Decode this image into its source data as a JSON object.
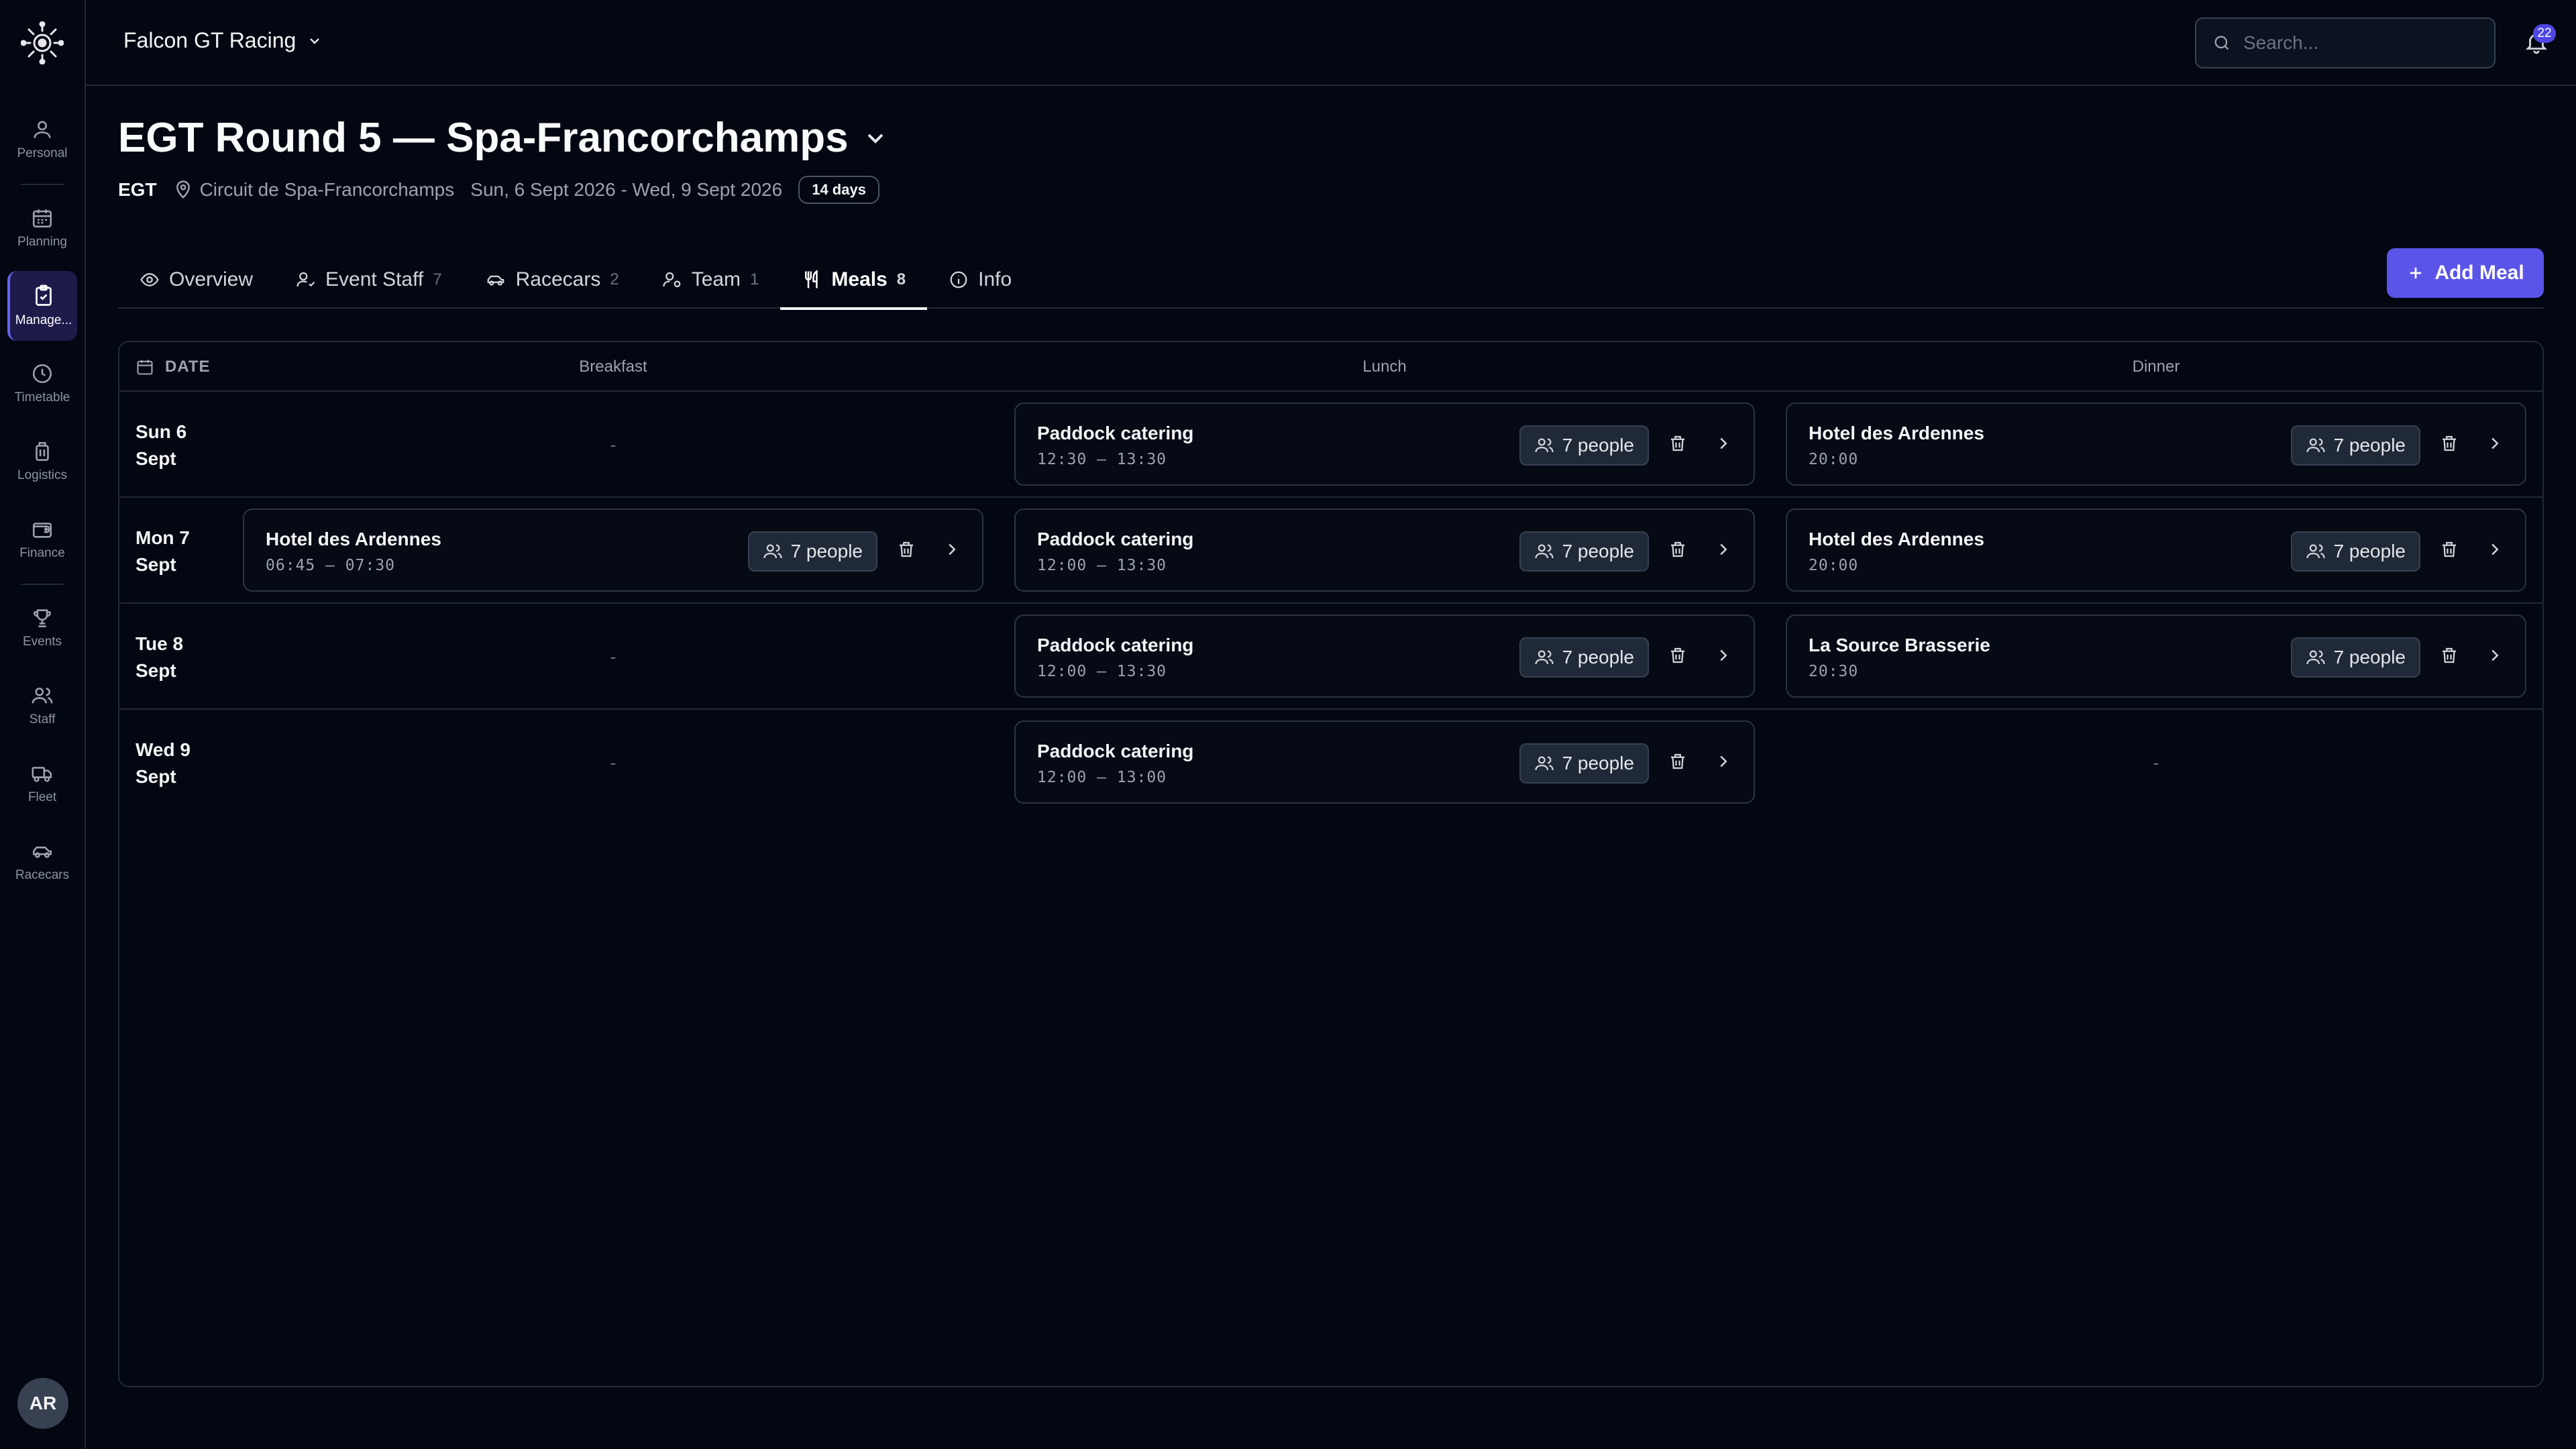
{
  "app": {
    "org_name": "Falcon GT Racing",
    "notifications_count": "22"
  },
  "search": {
    "placeholder": "Search..."
  },
  "sidebar": {
    "items": [
      {
        "key": "personal",
        "label": "Personal",
        "icon": "user-icon"
      },
      {
        "key": "planning",
        "label": "Planning",
        "icon": "calendar-icon"
      },
      {
        "key": "manage",
        "label": "Manage...",
        "icon": "clipboard-check-icon"
      },
      {
        "key": "timetable",
        "label": "Timetable",
        "icon": "clock-icon"
      },
      {
        "key": "logistics",
        "label": "Logistics",
        "icon": "luggage-icon"
      },
      {
        "key": "finance",
        "label": "Finance",
        "icon": "wallet-icon"
      },
      {
        "key": "events",
        "label": "Events",
        "icon": "trophy-icon"
      },
      {
        "key": "staff",
        "label": "Staff",
        "icon": "users-icon"
      },
      {
        "key": "fleet",
        "label": "Fleet",
        "icon": "truck-icon"
      },
      {
        "key": "racecars",
        "label": "Racecars",
        "icon": "car-icon"
      }
    ],
    "avatar_initials": "AR"
  },
  "event": {
    "title": "EGT Round 5 — Spa-Francorchamps",
    "series": "EGT",
    "location": "Circuit de Spa-Francorchamps",
    "dates": "Sun, 6 Sept 2026 - Wed, 9 Sept 2026",
    "duration": "14 days"
  },
  "tabs": [
    {
      "label": "Overview",
      "count": "",
      "icon": "eye-icon"
    },
    {
      "label": "Event Staff",
      "count": "7",
      "icon": "user-check-icon"
    },
    {
      "label": "Racecars",
      "count": "2",
      "icon": "car-icon"
    },
    {
      "label": "Team",
      "count": "1",
      "icon": "user-cog-icon"
    },
    {
      "label": "Meals",
      "count": "8",
      "icon": "utensils-icon"
    },
    {
      "label": "Info",
      "count": "",
      "icon": "info-icon"
    }
  ],
  "actions": {
    "add_meal": "Add Meal"
  },
  "meals_table": {
    "headers": {
      "date": "DATE",
      "breakfast": "Breakfast",
      "lunch": "Lunch",
      "dinner": "Dinner"
    },
    "empty_marker": "-",
    "rows": [
      {
        "day": "Sun 6",
        "month": "Sept",
        "breakfast": null,
        "lunch": {
          "name": "Paddock catering",
          "time": "12:30 – 13:30",
          "people": "7 people"
        },
        "dinner": {
          "name": "Hotel des Ardennes",
          "time": "20:00",
          "people": "7 people"
        }
      },
      {
        "day": "Mon 7",
        "month": "Sept",
        "breakfast": {
          "name": "Hotel des Ardennes",
          "time": "06:45 – 07:30",
          "people": "7 people"
        },
        "lunch": {
          "name": "Paddock catering",
          "time": "12:00 – 13:30",
          "people": "7 people"
        },
        "dinner": {
          "name": "Hotel des Ardennes",
          "time": "20:00",
          "people": "7 people"
        }
      },
      {
        "day": "Tue 8",
        "month": "Sept",
        "breakfast": null,
        "lunch": {
          "name": "Paddock catering",
          "time": "12:00 – 13:30",
          "people": "7 people"
        },
        "dinner": {
          "name": "La Source Brasserie",
          "time": "20:30",
          "people": "7 people"
        }
      },
      {
        "day": "Wed 9",
        "month": "Sept",
        "breakfast": null,
        "lunch": {
          "name": "Paddock catering",
          "time": "12:00 – 13:00",
          "people": "7 people"
        },
        "dinner": null
      }
    ]
  },
  "colors": {
    "accent": "#5b54e8",
    "background": "#030712",
    "border": "#1f2937"
  }
}
